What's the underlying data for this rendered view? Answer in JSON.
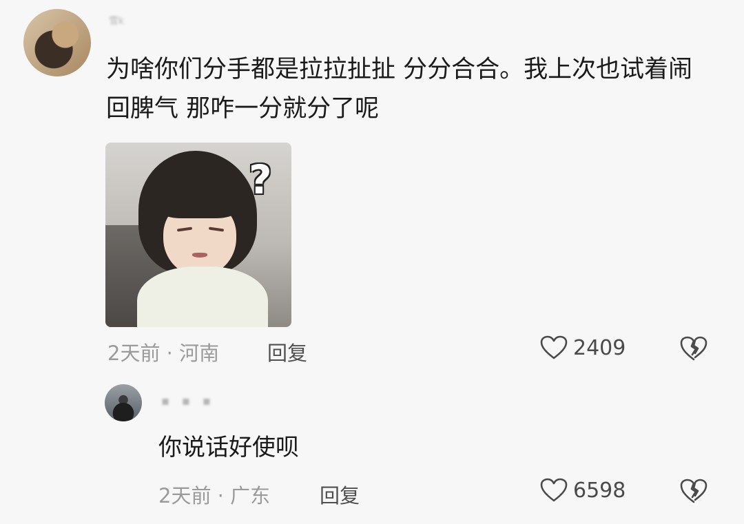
{
  "comment": {
    "username": "雪k",
    "text": "为啥你们分手都是拉拉扯扯 分分合合。我上次也试着闹回脾气 那咋一分就分了呢",
    "sticker_text": "?",
    "time": "2天前",
    "separator": "·",
    "location": "河南",
    "reply_label": "回复",
    "likes": "2409",
    "like_icon": "heart-outline-icon",
    "dislike_icon": "broken-heart-icon"
  },
  "reply": {
    "username": "▪ ▪ ▪",
    "text": "你说话好使呗",
    "time": "2天前",
    "separator": "·",
    "location": "广东",
    "reply_label": "回复",
    "likes": "6598",
    "like_icon": "heart-outline-icon",
    "dislike_icon": "broken-heart-icon"
  },
  "colors": {
    "background": "#f7f7f7",
    "text_primary": "#1a1a1a",
    "text_meta": "#9a9a9a",
    "icon": "#4a4a4a"
  }
}
